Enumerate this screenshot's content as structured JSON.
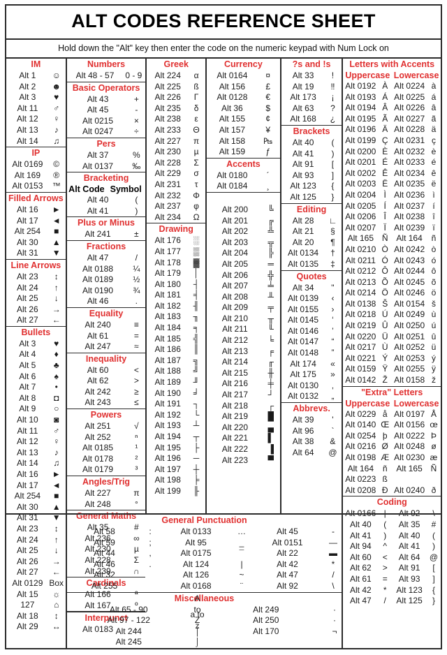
{
  "title": "ALT CODES REFERENCE SHEET",
  "instruction": "Hold down the \"Alt\" key then enter the code on the numeric keypad with Num Lock on",
  "colors": {
    "header": "#e03030",
    "text": "#1a1a1a",
    "border": "#2b2b2b"
  },
  "sections": {
    "im": {
      "title": "IM",
      "rows": [
        [
          "Alt 1",
          "☺"
        ],
        [
          "Alt 2",
          "☻"
        ],
        [
          "Alt 3",
          "♥"
        ],
        [
          "Alt 11",
          "♂"
        ],
        [
          "Alt 12",
          "♀"
        ],
        [
          "Alt 13",
          "♪"
        ],
        [
          "Alt 14",
          "♫"
        ]
      ]
    },
    "ip": {
      "title": "IP",
      "rows": [
        [
          "Alt 0169",
          "©"
        ],
        [
          "Alt 169",
          "®"
        ],
        [
          "Alt 0153",
          "™"
        ]
      ]
    },
    "filled_arrows": {
      "title": "Filled Arrows",
      "rows": [
        [
          "Alt 16",
          "►"
        ],
        [
          "Alt 17",
          "◄"
        ],
        [
          "Alt 254",
          "■"
        ],
        [
          "Alt 30",
          "▲"
        ],
        [
          "Alt 31",
          "▼"
        ]
      ]
    },
    "line_arrows": {
      "title": "Line Arrows",
      "rows": [
        [
          "Alt 23",
          "↕"
        ],
        [
          "Alt 24",
          "↑"
        ],
        [
          "Alt 25",
          "↓"
        ],
        [
          "Alt 26",
          "→"
        ],
        [
          "Alt 27",
          "←"
        ]
      ]
    },
    "bullets": {
      "title": "Bullets",
      "rows": [
        [
          "Alt 3",
          "♥"
        ],
        [
          "Alt 4",
          "♦"
        ],
        [
          "Alt 5",
          "♣"
        ],
        [
          "Alt 6",
          "♠"
        ],
        [
          "Alt 7",
          "•"
        ],
        [
          "Alt 8",
          "◘"
        ],
        [
          "Alt 9",
          "○"
        ],
        [
          "Alt 10",
          "◙"
        ],
        [
          "Alt 11",
          "♂"
        ],
        [
          "Alt 12",
          "♀"
        ],
        [
          "Alt 13",
          "♪"
        ],
        [
          "Alt 14",
          "♫"
        ],
        [
          "Alt 16",
          "►"
        ],
        [
          "Alt 17",
          "◄"
        ],
        [
          "Alt 254",
          "■"
        ],
        [
          "Alt 30",
          "▲"
        ],
        [
          "Alt 31",
          "▼"
        ],
        [
          "Alt 23",
          "↕"
        ],
        [
          "Alt 24",
          "↑"
        ],
        [
          "Alt 25",
          "↓"
        ],
        [
          "Alt 26",
          "→"
        ],
        [
          "Alt 27",
          "←"
        ],
        [
          "Alt 0129",
          "Box"
        ],
        [
          "Alt 15",
          "☼"
        ],
        [
          "127",
          "⌂"
        ],
        [
          "Alt 18",
          "↕"
        ],
        [
          "Alt 29",
          "↔"
        ]
      ]
    },
    "numbers": {
      "title": "Numbers",
      "rows": [
        [
          "Alt 48 - 57",
          "0 - 9"
        ]
      ]
    },
    "basic_operators": {
      "title": "Basic Operators",
      "rows": [
        [
          "Alt 43",
          "+"
        ],
        [
          "Alt 45",
          "-"
        ],
        [
          "Alt 0215",
          "×"
        ],
        [
          "Alt 0247",
          "÷"
        ]
      ]
    },
    "pers": {
      "title": "Pers",
      "rows": [
        [
          "Alt 37",
          "%"
        ],
        [
          "Alt 0137",
          "‰"
        ]
      ]
    },
    "bracketing": {
      "title": "Bracketing",
      "sub": [
        "Alt Code",
        "Symbol"
      ],
      "rows": [
        [
          "Alt 40",
          "("
        ],
        [
          "Alt 41",
          ")"
        ]
      ]
    },
    "plus_or_minus": {
      "title": "Plus or Minus",
      "rows": [
        [
          "Alt 241",
          "±"
        ]
      ]
    },
    "fractions": {
      "title": "Fractions",
      "rows": [
        [
          "Alt 47",
          "/"
        ],
        [
          "Alt 0188",
          "¼"
        ],
        [
          "Alt 0189",
          "½"
        ],
        [
          "Alt 0190",
          "¾"
        ],
        [
          "Alt 46",
          "."
        ]
      ]
    },
    "equality": {
      "title": "Equality",
      "rows": [
        [
          "Alt 240",
          "≡"
        ],
        [
          "Alt 61",
          "="
        ],
        [
          "Alt 247",
          "≈"
        ]
      ]
    },
    "inequality": {
      "title": "Inequality",
      "rows": [
        [
          "Alt 60",
          "<"
        ],
        [
          "Alt 62",
          ">"
        ],
        [
          "Alt 242",
          "≥"
        ],
        [
          "Alt 243",
          "≤"
        ]
      ]
    },
    "powers": {
      "title": "Powers",
      "rows": [
        [
          "Alt 251",
          "√"
        ],
        [
          "Alt 252",
          "ⁿ"
        ],
        [
          "Alt 0185",
          "¹"
        ],
        [
          "Alt 0178",
          "²"
        ],
        [
          "Alt 0179",
          "³"
        ]
      ]
    },
    "angles_trig": {
      "title": "Angles/Trig",
      "rows": [
        [
          "Alt 227",
          "π"
        ],
        [
          "Alt 248",
          "°"
        ]
      ]
    },
    "general_maths": {
      "title": "General Maths",
      "rows": [
        [
          "Alt 35",
          "#"
        ],
        [
          "Alt 236",
          "∞"
        ],
        [
          "Alt 230",
          "µ"
        ],
        [
          "Alt 228",
          "Σ"
        ],
        [
          "Alt 239",
          "∩"
        ]
      ]
    },
    "cardinals": {
      "title": "Cardinals",
      "rows": [
        [
          "Alt 166",
          "ª"
        ],
        [
          "Alt 167",
          "º"
        ]
      ]
    },
    "interpunct": {
      "title": "Interpunct",
      "rows": [
        [
          "Alt 0183",
          "·"
        ]
      ]
    },
    "greek": {
      "title": "Greek",
      "rows": [
        [
          "Alt 224",
          "α"
        ],
        [
          "Alt 225",
          "ß"
        ],
        [
          "Alt 226",
          "Γ"
        ],
        [
          "Alt 235",
          "δ"
        ],
        [
          "Alt 238",
          "ε"
        ],
        [
          "Alt 233",
          "Θ"
        ],
        [
          "Alt 227",
          "π"
        ],
        [
          "Alt 230",
          "µ"
        ],
        [
          "Alt 228",
          "Σ"
        ],
        [
          "Alt 229",
          "σ"
        ],
        [
          "Alt 231",
          "τ"
        ],
        [
          "Alt 232",
          "Φ"
        ],
        [
          "Alt 237",
          "φ"
        ],
        [
          "Alt 234",
          "Ω"
        ]
      ]
    },
    "currency": {
      "title": "Currency",
      "rows": [
        [
          "Alt 0164",
          "¤"
        ],
        [
          "Alt 156",
          "£"
        ],
        [
          "Alt 0128",
          "€"
        ],
        [
          "Alt 36",
          "$"
        ],
        [
          "Alt 155",
          "¢"
        ],
        [
          "Alt 157",
          "¥"
        ],
        [
          "Alt 158",
          "₧"
        ],
        [
          "Alt 159",
          "ƒ"
        ]
      ]
    },
    "accents": {
      "title": "Accents",
      "rows": [
        [
          "Alt 0180",
          "´"
        ],
        [
          "Alt 0184",
          "¸"
        ]
      ]
    },
    "drawing": {
      "title": "Drawing",
      "left": [
        [
          "Alt 176",
          "░"
        ],
        [
          "Alt 177",
          "▒"
        ],
        [
          "Alt 178",
          "▓"
        ],
        [
          "Alt 179",
          "│"
        ],
        [
          "Alt 180",
          "┤"
        ],
        [
          "Alt 181",
          "╡"
        ],
        [
          "Alt 182",
          "╢"
        ],
        [
          "Alt 183",
          "╖"
        ],
        [
          "Alt 184",
          "╕"
        ],
        [
          "Alt 185",
          "╣"
        ],
        [
          "Alt 186",
          "║"
        ],
        [
          "Alt 187",
          "╗"
        ],
        [
          "Alt 188",
          "╝"
        ],
        [
          "Alt 189",
          "╜"
        ],
        [
          "Alt 190",
          "╛"
        ],
        [
          "Alt 191",
          "┐"
        ],
        [
          "Alt 192",
          "└"
        ],
        [
          "Alt 193",
          "┴"
        ],
        [
          "Alt 194",
          "┬"
        ],
        [
          "Alt 195",
          "├"
        ],
        [
          "Alt 196",
          "─"
        ],
        [
          "Alt 197",
          "┼"
        ],
        [
          "Alt 198",
          "╞"
        ],
        [
          "Alt 199",
          "╟"
        ]
      ],
      "right": [
        [
          "Alt 200",
          "╚"
        ],
        [
          "Alt 201",
          "╔"
        ],
        [
          "Alt 202",
          "╩"
        ],
        [
          "Alt 203",
          "╦"
        ],
        [
          "Alt 204",
          "╠"
        ],
        [
          "Alt 205",
          "═"
        ],
        [
          "Alt 206",
          "╬"
        ],
        [
          "Alt 207",
          "╧"
        ],
        [
          "Alt 208",
          "╨"
        ],
        [
          "Alt 209",
          "╤"
        ],
        [
          "Alt 210",
          "╥"
        ],
        [
          "Alt 211",
          "╙"
        ],
        [
          "Alt 212",
          "╘"
        ],
        [
          "Alt 213",
          "╒"
        ],
        [
          "Alt 214",
          "╓"
        ],
        [
          "Alt 215",
          "╫"
        ],
        [
          "Alt 216",
          "╪"
        ],
        [
          "Alt 217",
          "┘"
        ],
        [
          "Alt 218",
          "┌"
        ],
        [
          "Alt 219",
          "█"
        ],
        [
          "Alt 220",
          "▄"
        ],
        [
          "Alt 221",
          "▌"
        ],
        [
          "Alt 222",
          "▐"
        ],
        [
          "Alt 223",
          "▀"
        ]
      ]
    },
    "qs_and_es": {
      "title": "?s and !s",
      "rows": [
        [
          "Alt 33",
          "!"
        ],
        [
          "Alt 19",
          "‼"
        ],
        [
          "Alt 173",
          "¡"
        ],
        [
          "Alt 63",
          "?"
        ],
        [
          "Alt 168",
          "¿"
        ]
      ]
    },
    "brackets": {
      "title": "Brackets",
      "rows": [
        [
          "Alt 40",
          "("
        ],
        [
          "Alt 41",
          ")"
        ],
        [
          "Alt 91",
          "["
        ],
        [
          "Alt 93",
          "]"
        ],
        [
          "Alt 123",
          "{"
        ],
        [
          "Alt 125",
          "}"
        ]
      ]
    },
    "editing": {
      "title": "Editing",
      "rows": [
        [
          "Alt 28",
          "∟"
        ],
        [
          "Alt 21",
          "§"
        ],
        [
          "Alt 20",
          "¶"
        ],
        [
          "Alt 0134",
          "†"
        ],
        [
          "Alt 0135",
          "‡"
        ]
      ]
    },
    "quotes": {
      "title": "Quotes",
      "rows": [
        [
          "Alt 34",
          "\""
        ],
        [
          "Alt 0139",
          "‹"
        ],
        [
          "Alt 0155",
          "›"
        ],
        [
          "Alt 0145",
          "‘"
        ],
        [
          "Alt 0146",
          "’"
        ],
        [
          "Alt 0147",
          "“"
        ],
        [
          "Alt 0148",
          "”"
        ],
        [
          "Alt 174",
          "«"
        ],
        [
          "Alt 175",
          "»"
        ],
        [
          "Alt 0130",
          "‚"
        ],
        [
          "Alt 0132",
          "„"
        ]
      ]
    },
    "abbrevs": {
      "title": "Abbrevs.",
      "rows": [
        [
          "Alt 39",
          "'"
        ],
        [
          "Alt 96",
          "`"
        ],
        [
          "Alt 38",
          "&"
        ],
        [
          "Alt 64",
          "@"
        ]
      ]
    },
    "letters_with_accents": {
      "title": "Letters with Accents",
      "sub": [
        "Uppercase",
        "Lowercase"
      ],
      "rows": [
        [
          "Alt 0192",
          "À",
          "Alt 0224",
          "à"
        ],
        [
          "Alt 0193",
          "Á",
          "Alt 0225",
          "á"
        ],
        [
          "Alt 0194",
          "Â",
          "Alt 0226",
          "â"
        ],
        [
          "Alt 0195",
          "Ã",
          "Alt 0227",
          "ã"
        ],
        [
          "Alt 0196",
          "Ä",
          "Alt 0228",
          "ä"
        ],
        [
          "Alt 0199",
          "Ç",
          "Alt 0231",
          "ç"
        ],
        [
          "Alt 0200",
          "È",
          "Alt 0232",
          "è"
        ],
        [
          "Alt 0201",
          "É",
          "Alt 0233",
          "é"
        ],
        [
          "Alt 0202",
          "Ê",
          "Alt 0234",
          "ê"
        ],
        [
          "Alt 0203",
          "Ë",
          "Alt 0235",
          "ë"
        ],
        [
          "Alt 0204",
          "Ì",
          "Alt 0236",
          "ì"
        ],
        [
          "Alt 0205",
          "Í",
          "Alt 0237",
          "í"
        ],
        [
          "Alt 0206",
          "Î",
          "Alt 0238",
          "î"
        ],
        [
          "Alt 0207",
          "Ï",
          "Alt 0239",
          "ï"
        ],
        [
          "Alt 165",
          "Ñ",
          "Alt 164",
          "ñ"
        ],
        [
          "Alt 0210",
          "Ò",
          "Alt 0242",
          "ò"
        ],
        [
          "Alt 0211",
          "Ó",
          "Alt 0243",
          "ó"
        ],
        [
          "Alt 0212",
          "Ô",
          "Alt 0244",
          "ô"
        ],
        [
          "Alt 0213",
          "Õ",
          "Alt 0245",
          "õ"
        ],
        [
          "Alt 0214",
          "Ö",
          "Alt 0246",
          "ö"
        ],
        [
          "Alt 0138",
          "Š",
          "Alt 0154",
          "š"
        ],
        [
          "Alt 0218",
          "Ú",
          "Alt 0249",
          "ù"
        ],
        [
          "Alt 0219",
          "Û",
          "Alt 0250",
          "ú"
        ],
        [
          "Alt 0220",
          "Ü",
          "Alt 0251",
          "û"
        ],
        [
          "Alt 0217",
          "Ù",
          "Alt 0252",
          "ü"
        ],
        [
          "Alt 0221",
          "Ý",
          "Alt 0253",
          "ý"
        ],
        [
          "Alt 0159",
          "Ÿ",
          "Alt 0255",
          "ÿ"
        ],
        [
          "Alt 0142",
          "Ž",
          "Alt 0158",
          "ž"
        ]
      ]
    },
    "extra_letters": {
      "title": "\"Extra\" Letters",
      "sub": [
        "Uppercase",
        "Lowercase"
      ],
      "rows": [
        [
          "Alt 0229",
          "å",
          "Alt 0197",
          "Å"
        ],
        [
          "Alt 0140",
          "Œ",
          "Alt 0156",
          "œ"
        ],
        [
          "Alt 0254",
          "þ",
          "Alt 0222",
          "Þ"
        ],
        [
          "Alt 0216",
          "Ø",
          "Alt 0248",
          "ø"
        ],
        [
          "Alt 0198",
          "Æ",
          "Alt 0230",
          "æ"
        ],
        [
          "Alt 164",
          "ñ",
          "Alt 165",
          "Ñ"
        ],
        [
          "Alt 0223",
          "ß",
          "",
          ""
        ],
        [
          "Alt 0208",
          "Ð",
          "Alt 0240",
          "ð"
        ]
      ]
    },
    "coding": {
      "title": "Coding",
      "rows": [
        [
          "Alt 0166",
          "¦",
          "Alt 92",
          "\\"
        ],
        [
          "Alt 40",
          "(",
          "Alt 35",
          "#"
        ],
        [
          "Alt 41",
          ")",
          "Alt 40",
          "("
        ],
        [
          "Alt 94",
          "^",
          "Alt 41",
          ")"
        ],
        [
          "Alt 60",
          "<",
          "Alt 64",
          "@"
        ],
        [
          "Alt 62",
          ">",
          "Alt 91",
          "["
        ],
        [
          "Alt 61",
          "=",
          "Alt 93",
          "]"
        ],
        [
          "Alt 42",
          "*",
          "Alt 123",
          "{"
        ],
        [
          "Alt 47",
          "/",
          "Alt 125",
          "}"
        ]
      ]
    },
    "general_punctuation": {
      "title": "General Punctuation",
      "rows": [
        [
          "Alt 58",
          ":",
          "Alt 0133",
          "…",
          "Alt 45",
          "-"
        ],
        [
          "Alt 59",
          ";",
          "Alt 95",
          "_",
          "Alt 0151",
          "—"
        ],
        [
          "Alt 44",
          ",",
          "Alt 0175",
          "¯",
          "Alt 22",
          "▬"
        ],
        [
          "Alt 46",
          ".",
          "Alt 124",
          "|",
          "Alt 42",
          "*"
        ],
        [
          "Alt 32",
          " ",
          "Alt 126",
          "~",
          "Alt 47",
          "/"
        ],
        [
          "Alt 255",
          " ",
          "Alt 0168",
          "¨",
          "Alt 92",
          "\\"
        ]
      ]
    },
    "miscellaneous": {
      "title": "Miscellaneous",
      "rows": [
        [
          "Alt 65 - 90",
          "A to Z",
          "Alt 249",
          "·"
        ],
        [
          "Alt 97 - 122",
          "a to z",
          "Alt 250",
          "·"
        ],
        [
          "Alt 244",
          "⌠",
          "Alt 170",
          "¬"
        ],
        [
          "Alt 245",
          "⌡",
          "",
          ""
        ]
      ]
    }
  }
}
